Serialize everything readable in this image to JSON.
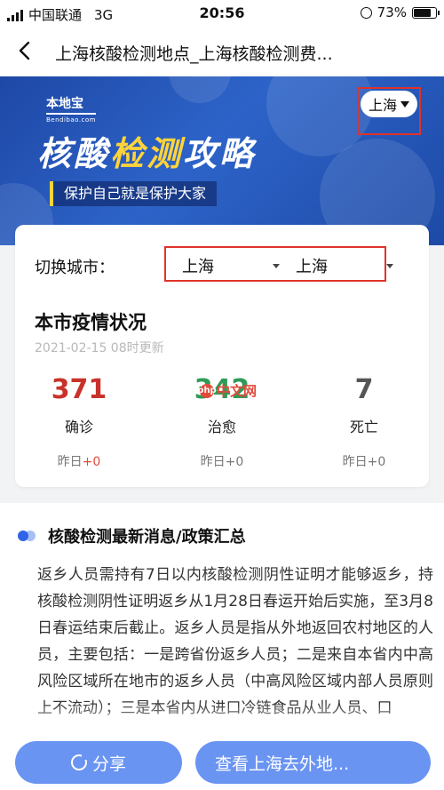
{
  "status_bar": {
    "carrier": "中国联通",
    "network": "3G",
    "time": "20:56",
    "battery": "73%"
  },
  "nav": {
    "title": "上海核酸检测地点_上海核酸检测费..."
  },
  "banner": {
    "logo_main": "本地宝",
    "logo_sub": "Bendibao.com",
    "title_part1": "核酸",
    "title_highlight": "检测",
    "title_part2": "攻略",
    "slogan": "保护自己就是保护大家",
    "city": "上海"
  },
  "card": {
    "switch_label": "切换城市：",
    "province": "上海",
    "city": "上海",
    "heading": "本市疫情状况",
    "updated": "2021-02-15 08时更新",
    "stats": [
      {
        "value": "371",
        "label": "确诊",
        "delta_prefix": "昨日",
        "delta": "+0",
        "color": "#c9322a"
      },
      {
        "value": "342",
        "label": "治愈",
        "delta_prefix": "昨日",
        "delta": "+0",
        "color": "#2e9a57"
      },
      {
        "value": "7",
        "label": "死亡",
        "delta_prefix": "昨日",
        "delta": "+0",
        "color": "#555555"
      }
    ],
    "watermark": "中文网"
  },
  "news": {
    "title": "核酸检测最新消息/政策汇总",
    "body": "返乡人员需持有7日以内核酸检测阴性证明才能够返乡，持核酸检测阴性证明返乡从1月28日春运开始后实施，至3月8日春运结束后截止。返乡人员是指从外地返回农村地区的人员，主要包括：一是跨省份返乡人员；二是来自本省内中高风险区域所在地市的返乡人员（中高风险区域内部人员原则上不流动）；三是本省内从进口冷链食品从业人员、口"
  },
  "actions": {
    "share": "分享",
    "view": "查看上海去外地..."
  },
  "colors": {
    "accent": "#2f63e8",
    "button": "#6a94f2",
    "highlight_box": "#e0322a"
  }
}
